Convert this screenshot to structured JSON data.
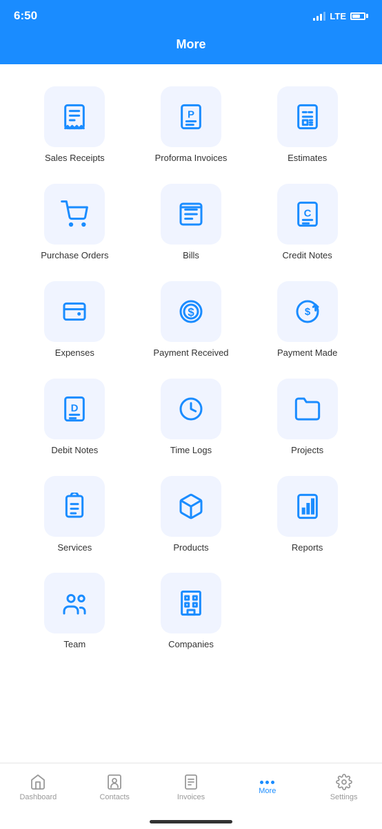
{
  "statusBar": {
    "time": "6:50",
    "lte": "LTE"
  },
  "header": {
    "title": "More"
  },
  "grid": {
    "items": [
      {
        "id": "sales-receipts",
        "label": "Sales Receipts",
        "icon": "receipt"
      },
      {
        "id": "proforma-invoices",
        "label": "Proforma Invoices",
        "icon": "proforma"
      },
      {
        "id": "estimates",
        "label": "Estimates",
        "icon": "estimates"
      },
      {
        "id": "purchase-orders",
        "label": "Purchase Orders",
        "icon": "cart"
      },
      {
        "id": "bills",
        "label": "Bills",
        "icon": "bills"
      },
      {
        "id": "credit-notes",
        "label": "Credit Notes",
        "icon": "creditnotes"
      },
      {
        "id": "expenses",
        "label": "Expenses",
        "icon": "wallet"
      },
      {
        "id": "payment-received",
        "label": "Payment Received",
        "icon": "payreceived"
      },
      {
        "id": "payment-made",
        "label": "Payment Made",
        "icon": "paymade"
      },
      {
        "id": "debit-notes",
        "label": "Debit Notes",
        "icon": "debitnotes"
      },
      {
        "id": "time-logs",
        "label": "Time Logs",
        "icon": "clock"
      },
      {
        "id": "projects",
        "label": "Projects",
        "icon": "folder"
      },
      {
        "id": "services",
        "label": "Services",
        "icon": "clipboard"
      },
      {
        "id": "products",
        "label": "Products",
        "icon": "box"
      },
      {
        "id": "reports",
        "label": "Reports",
        "icon": "barchart"
      },
      {
        "id": "team",
        "label": "Team",
        "icon": "team"
      },
      {
        "id": "companies",
        "label": "Companies",
        "icon": "companies"
      }
    ]
  },
  "bottomNav": {
    "items": [
      {
        "id": "dashboard",
        "label": "Dashboard",
        "icon": "home",
        "active": false
      },
      {
        "id": "contacts",
        "label": "Contacts",
        "icon": "contacts",
        "active": false
      },
      {
        "id": "invoices",
        "label": "Invoices",
        "icon": "invoices",
        "active": false
      },
      {
        "id": "more",
        "label": "More",
        "icon": "more",
        "active": true
      },
      {
        "id": "settings",
        "label": "Settings",
        "icon": "settings",
        "active": false
      }
    ]
  }
}
